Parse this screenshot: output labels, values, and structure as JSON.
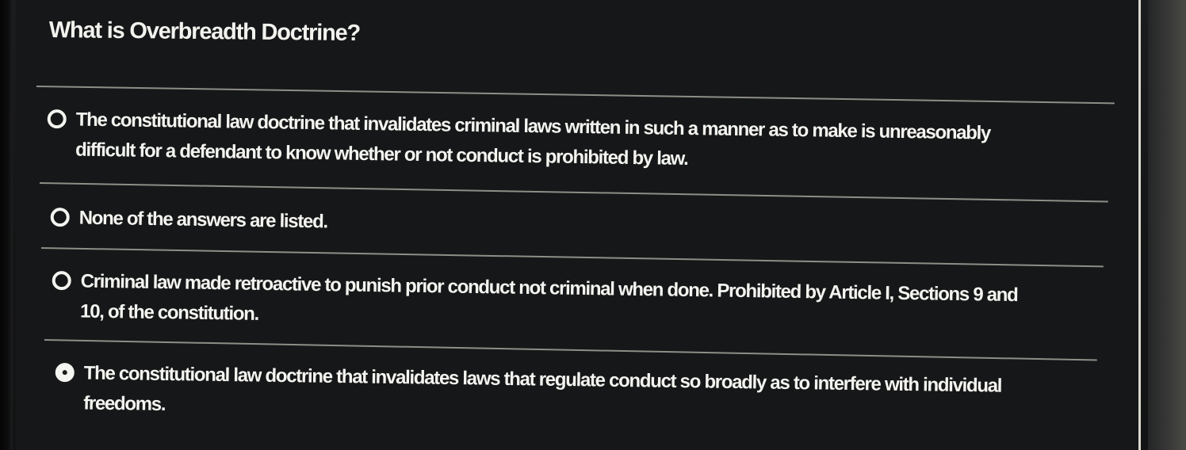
{
  "question": {
    "title": "What is Overbreadth Doctrine?"
  },
  "options": [
    {
      "text": "The constitutional law doctrine that invalidates criminal laws written in such a manner as to make is unreasonably difficult for a defendant to know whether or not conduct is prohibited by law.",
      "selected": false
    },
    {
      "text": "None of the answers are listed.",
      "selected": false
    },
    {
      "text": "Criminal law made retroactive to punish prior conduct not criminal when done. Prohibited by Article I, Sections 9 and 10, of the constitution.",
      "selected": false
    },
    {
      "text": "The constitutional law doctrine that invalidates laws that regulate conduct so broadly as to interfere with individual freedoms.",
      "selected": true
    }
  ]
}
